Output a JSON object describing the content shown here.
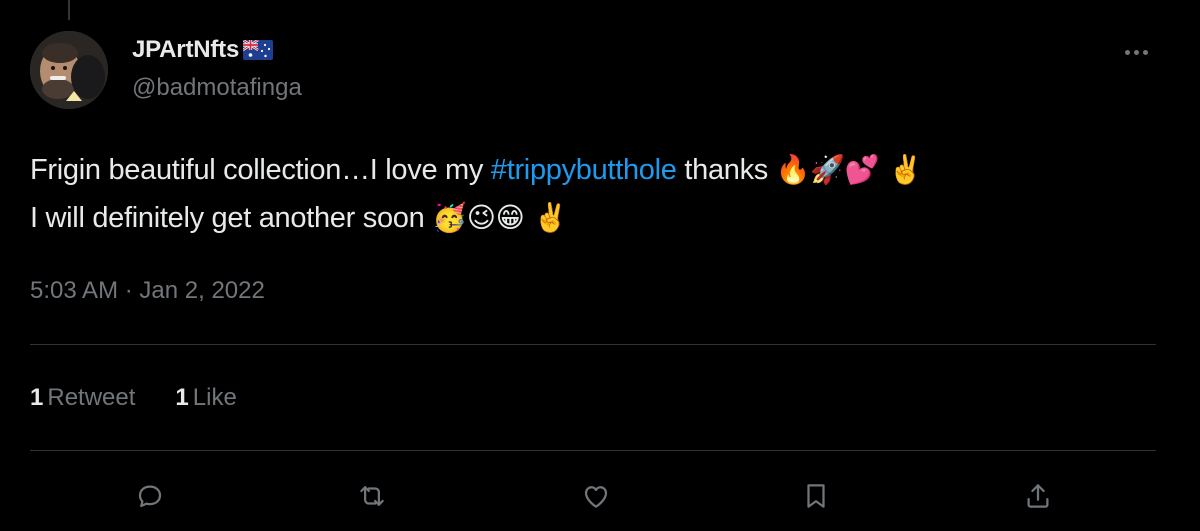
{
  "tweet": {
    "author": {
      "display_name": "JPArtNfts",
      "handle": "@badmotafinga",
      "flag_icon": "australia-flag-icon"
    },
    "text": {
      "line1_before": "Frigin beautiful collection…I love my ",
      "hashtag": "#trippybutthole",
      "line1_after": " thanks ",
      "line1_emojis": "🔥🚀💕 ✌️",
      "line2_text": "I will definitely get another soon ",
      "line2_emojis": "🥳😉😁 ✌️"
    },
    "time": "5:03 AM",
    "separator": "·",
    "date": "Jan 2, 2022",
    "stats": {
      "retweets_count": "1",
      "retweets_label": "Retweet",
      "likes_count": "1",
      "likes_label": "Like"
    },
    "actions": [
      "reply-icon",
      "retweet-icon",
      "like-icon",
      "bookmark-icon",
      "share-icon"
    ]
  },
  "colors": {
    "background": "#000000",
    "text_primary": "#e7e9ea",
    "text_secondary": "#71767b",
    "link": "#1d9bf0",
    "divider": "#2f3336"
  }
}
